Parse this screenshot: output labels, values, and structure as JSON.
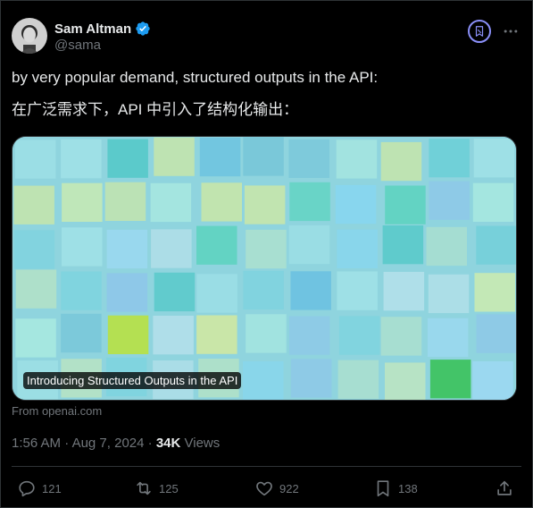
{
  "author": {
    "display_name": "Sam Altman",
    "handle": "@sama",
    "verified_icon": "verified-badge-icon"
  },
  "tweet": {
    "text_line1": "by very popular demand, structured outputs in the API:",
    "text_line2": "在广泛需求下，API 中引入了结构化输出："
  },
  "card": {
    "title": "Introducing Structured Outputs in the API",
    "source": "From openai.com"
  },
  "meta": {
    "time": "1:56 AM",
    "separator": " · ",
    "date": "Aug 7, 2024",
    "views_count": "34K",
    "views_label": " Views"
  },
  "actions": {
    "replies": "121",
    "reposts": "125",
    "likes": "922",
    "bookmarks": "138"
  },
  "colors": {
    "background": "#000000",
    "text": "#e7e9ea",
    "muted": "#71767b",
    "verified": "#1d9bf0",
    "grok_accent": "#8a8ff8"
  }
}
